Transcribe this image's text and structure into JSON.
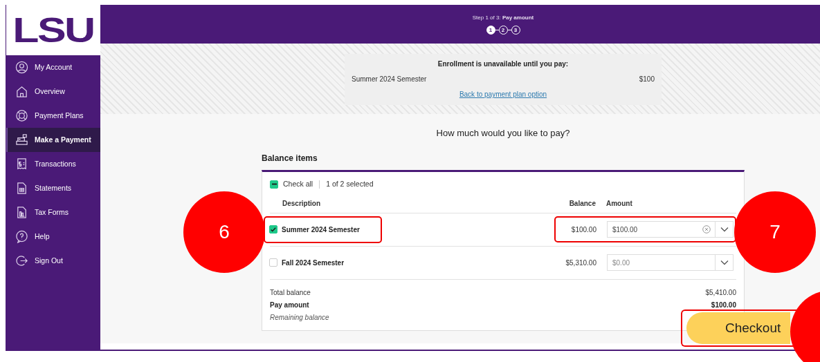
{
  "logo": {
    "text": "LSU"
  },
  "sidebar": {
    "items": [
      {
        "label": "My Account",
        "selected": false
      },
      {
        "label": "Overview",
        "selected": false
      },
      {
        "label": "Payment Plans",
        "selected": false
      },
      {
        "label": "Make a Payment",
        "selected": true
      },
      {
        "label": "Transactions",
        "selected": false
      },
      {
        "label": "Statements",
        "selected": false
      },
      {
        "label": "Tax Forms",
        "selected": false
      },
      {
        "label": "Help",
        "selected": false
      },
      {
        "label": "Sign Out",
        "selected": false
      }
    ]
  },
  "header": {
    "step_prefix": "Step 1 of 3:",
    "step_title": "Pay amount",
    "steps": [
      {
        "label": "1",
        "selected": true
      },
      {
        "label": "2",
        "selected": false
      },
      {
        "label": "3",
        "selected": false
      }
    ]
  },
  "notice": {
    "title": "Enrollment is unavailable until you pay:",
    "item": "Summer 2024 Semester",
    "amount": "$100",
    "link": "Back to payment plan option"
  },
  "question": "How much would you like to pay?",
  "balance_items": {
    "title": "Balance items",
    "check_all": {
      "label": "Check all",
      "indeterminate": true
    },
    "selected_count": "1 of 2 selected",
    "columns": [
      "Description",
      "Balance",
      "Amount"
    ],
    "rows": [
      {
        "description": "Summer 2024 Semester",
        "checked": true,
        "balance": "$100.00",
        "amount": "$100.00",
        "outlined": true
      },
      {
        "description": "Fall 2024 Semester",
        "checked": false,
        "balance": "$5,310.00",
        "placeholder": "$0.00",
        "outlined": false
      }
    ],
    "totals": [
      {
        "label": "Total balance",
        "value": "$5,410.00",
        "kind": "normal"
      },
      {
        "label": "Pay amount",
        "value": "$100.00",
        "kind": "bold"
      },
      {
        "label": "Remaining balance",
        "kind": "italic"
      }
    ]
  },
  "checkout": {
    "label": "Checkout",
    "outlined": true
  },
  "annotations": [
    {
      "kind": "marker",
      "label": "6"
    },
    {
      "kind": "marker",
      "label": "7"
    },
    {
      "kind": "marker"
    }
  ]
}
